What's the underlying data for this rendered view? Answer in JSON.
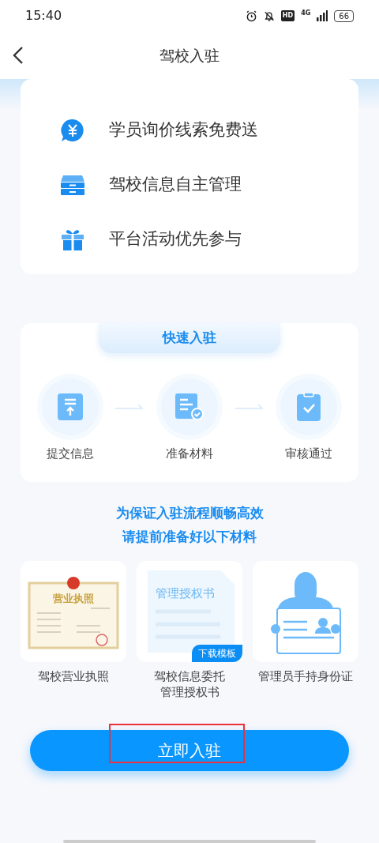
{
  "status_bar": {
    "time": "15:40",
    "hd_badge": "HD",
    "network": "4G",
    "battery": "66"
  },
  "header": {
    "title": "驾校入驻"
  },
  "benefits": [
    {
      "text": "学员询价线索免费送",
      "kind": "yuan"
    },
    {
      "text": "驾校信息自主管理",
      "kind": "cabinet"
    },
    {
      "text": "平台活动优先参与",
      "kind": "gift"
    }
  ],
  "process": {
    "title": "快速入驻",
    "steps": [
      {
        "label": "提交信息",
        "kind": "upload"
      },
      {
        "label": "准备材料",
        "kind": "document"
      },
      {
        "label": "审核通过",
        "kind": "clipboard"
      }
    ]
  },
  "notice": [
    "为保证入驻流程顺畅高效",
    "请提前准备好以下材料"
  ],
  "materials": [
    {
      "label_lines": [
        "驾校营业执照"
      ],
      "kind": "license",
      "picture_title": "营业执照"
    },
    {
      "label_lines": [
        "驾校信息委托",
        "管理授权书"
      ],
      "kind": "authorization",
      "picture_title": "管理授权书",
      "badge": "下载模板"
    },
    {
      "label_lines": [
        "管理员手持身份证"
      ],
      "kind": "id_card"
    }
  ],
  "submit_button": {
    "label": "立即入驻",
    "highlighted": true
  }
}
